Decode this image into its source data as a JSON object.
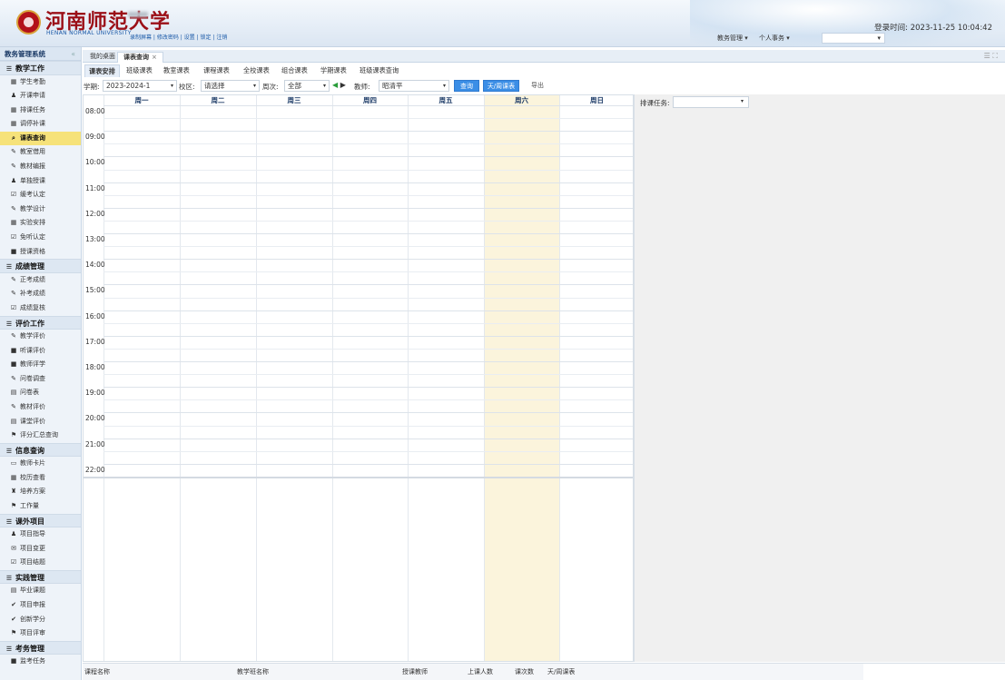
{
  "header": {
    "logo_cn": "河南师范大学",
    "logo_en": "HENAN NORMAL UNIVERSITY",
    "top_links": "录制屏幕 | 修改密码 | 设置 | 锁定 | 注销",
    "login_time": "登录时间: 2023-11-25 10:04:42",
    "menus": [
      "教务管理 ▾",
      "个人事务 ▾"
    ]
  },
  "sidebar": {
    "title": "教务管理系统",
    "collapse": "«",
    "sections": [
      {
        "title": "教学工作",
        "items": [
          {
            "icon": "calendar-icon",
            "glyph": "▦",
            "label": "学生考勤"
          },
          {
            "icon": "users-icon",
            "glyph": "♟",
            "label": "开课申请"
          },
          {
            "icon": "grid-icon",
            "glyph": "▦",
            "label": "排课任务"
          },
          {
            "icon": "grid-icon",
            "glyph": "▦",
            "label": "调停补课"
          },
          {
            "icon": "search-icon",
            "glyph": "⌕",
            "label": "课表查询",
            "active": true
          },
          {
            "icon": "edit-icon",
            "glyph": "✎",
            "label": "教室借用"
          },
          {
            "icon": "edit-icon",
            "glyph": "✎",
            "label": "教材编报"
          },
          {
            "icon": "users-icon",
            "glyph": "♟",
            "label": "单独授课"
          },
          {
            "icon": "check-square-icon",
            "glyph": "☑",
            "label": "缓考认定"
          },
          {
            "icon": "pencil-icon",
            "glyph": "✎",
            "label": "教学设计"
          },
          {
            "icon": "calendar-icon",
            "glyph": "▦",
            "label": "实验安排"
          },
          {
            "icon": "check-square-icon",
            "glyph": "☑",
            "label": "免听认定"
          },
          {
            "icon": "doc-icon",
            "glyph": "■",
            "label": "授课资格"
          }
        ]
      },
      {
        "title": "成绩管理",
        "items": [
          {
            "icon": "pencil-icon",
            "glyph": "✎",
            "label": "正考成绩"
          },
          {
            "icon": "pencil-icon",
            "glyph": "✎",
            "label": "补考成绩"
          },
          {
            "icon": "check-square-icon",
            "glyph": "☑",
            "label": "成绩复核"
          }
        ]
      },
      {
        "title": "评价工作",
        "items": [
          {
            "icon": "pencil-icon",
            "glyph": "✎",
            "label": "教学评价"
          },
          {
            "icon": "doc-icon",
            "glyph": "■",
            "label": "听课评价"
          },
          {
            "icon": "doc-icon",
            "glyph": "■",
            "label": "教师评学"
          },
          {
            "icon": "pencil-icon",
            "glyph": "✎",
            "label": "问卷调查"
          },
          {
            "icon": "file-icon",
            "glyph": "▤",
            "label": "问卷表"
          },
          {
            "icon": "pencil-icon",
            "glyph": "✎",
            "label": "教材评价"
          },
          {
            "icon": "file-icon",
            "glyph": "▤",
            "label": "课堂评价"
          },
          {
            "icon": "flag-icon",
            "glyph": "⚑",
            "label": "评分汇总查询"
          }
        ]
      },
      {
        "title": "信息查询",
        "items": [
          {
            "icon": "card-icon",
            "glyph": "▭",
            "label": "教师卡片"
          },
          {
            "icon": "calendar-icon",
            "glyph": "▦",
            "label": "校历查看"
          },
          {
            "icon": "binoculars-icon",
            "glyph": "♜",
            "label": "培养方案"
          },
          {
            "icon": "flag-icon",
            "glyph": "⚑",
            "label": "工作量"
          }
        ]
      },
      {
        "title": "课外项目",
        "items": [
          {
            "icon": "users-icon",
            "glyph": "♟",
            "label": "项目指导"
          },
          {
            "icon": "comment-icon",
            "glyph": "✉",
            "label": "项目变更"
          },
          {
            "icon": "check-square-icon",
            "glyph": "☑",
            "label": "项目结题"
          }
        ]
      },
      {
        "title": "实践管理",
        "items": [
          {
            "icon": "file-icon",
            "glyph": "▤",
            "label": "毕业课题"
          },
          {
            "icon": "check-icon",
            "glyph": "✔",
            "label": "项目申报"
          },
          {
            "icon": "check-icon",
            "glyph": "✔",
            "label": "创新学分"
          },
          {
            "icon": "flag-icon",
            "glyph": "⚑",
            "label": "项目评审"
          }
        ]
      },
      {
        "title": "考务管理",
        "items": [
          {
            "icon": "doc-icon",
            "glyph": "■",
            "label": "监考任务"
          }
        ]
      }
    ]
  },
  "tabs": {
    "main": [
      {
        "label": "我的桌面"
      },
      {
        "label": "课表查询",
        "active": true,
        "close": "×"
      }
    ],
    "sub": [
      "课表安排",
      "班级课表",
      "教室课表",
      "课程课表",
      "全校课表",
      "组合课表",
      "学期课表",
      "班级课表查询"
    ],
    "corner_icons": "☰  ⛶"
  },
  "filter": {
    "term_label": "学期:",
    "term_value": "2023-2024-1",
    "campus_label": "校区:",
    "campus_value": "请选择",
    "week_label": "周次:",
    "week_value": "全部",
    "teacher_label": "教师:",
    "teacher_value": "昭清平",
    "query_button": "查询",
    "day_week_button": "天/周课表",
    "export_button": "导出"
  },
  "timetable": {
    "days": [
      "周一",
      "周二",
      "周三",
      "周四",
      "周五",
      "周六",
      "周日"
    ],
    "times": [
      "08:00",
      "09:00",
      "10:00",
      "11:00",
      "12:00",
      "13:00",
      "14:00",
      "15:00",
      "16:00",
      "17:00",
      "18:00",
      "19:00",
      "20:00",
      "21:00",
      "22:00"
    ]
  },
  "right_panel": {
    "task_label": "排课任务:"
  },
  "bottom": {
    "columns": [
      "课程名称",
      "教学班名称",
      "授课教师",
      "上课人数",
      "课次数",
      "天/周课表"
    ]
  }
}
